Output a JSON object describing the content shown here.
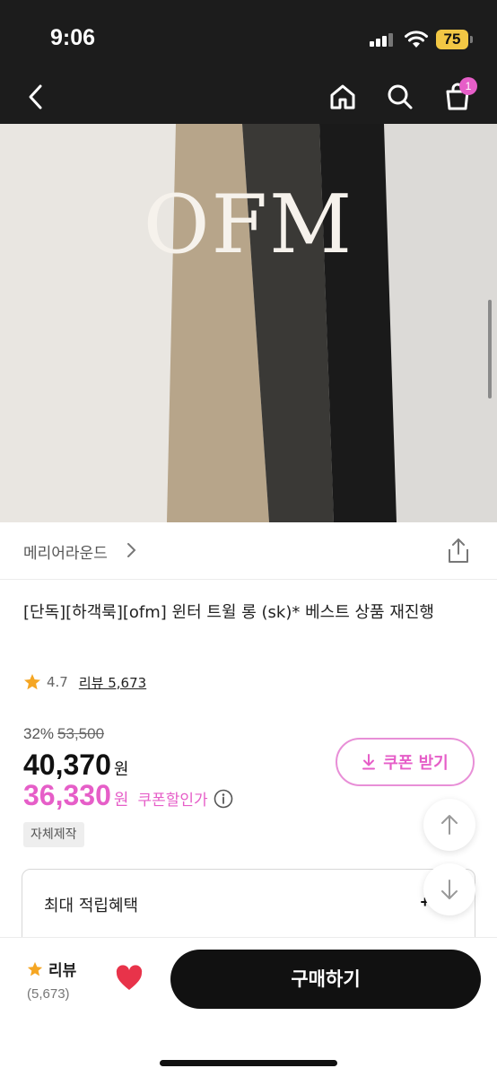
{
  "status_bar": {
    "time": "9:06",
    "battery": "75"
  },
  "nav": {
    "cart_badge": "1"
  },
  "hero": {
    "logo_text": "OFM",
    "swatch_colors": [
      "#e9e6e1",
      "#b7a58a",
      "#3a3936",
      "#1a1a1a",
      "#dcdad7"
    ]
  },
  "brand": {
    "name": "메리어라운드"
  },
  "product": {
    "title": "[단독][하객룩][ofm] 윈터 트윌 롱 (sk)* 베스트 상품 재진행",
    "rating": "4.7",
    "review_link": "리뷰 5,673",
    "discount_pct": "32%",
    "original_price": "53,500",
    "price": "40,370",
    "price_unit": "원",
    "coupon_price": "36,330",
    "coupon_price_unit": "원",
    "coupon_label": "쿠폰할인가",
    "tag": "자체제작"
  },
  "coupon_button": {
    "label": "쿠폰 받기"
  },
  "benefit": {
    "label": "최대 적립혜택",
    "value": "+ 8."
  },
  "bottom_bar": {
    "review_label": "리뷰",
    "review_count": "(5,673)",
    "buy_label": "구매하기"
  },
  "colors": {
    "accent_pink": "#e65ec8",
    "star": "#f5a623",
    "heart": "#e8334a"
  }
}
